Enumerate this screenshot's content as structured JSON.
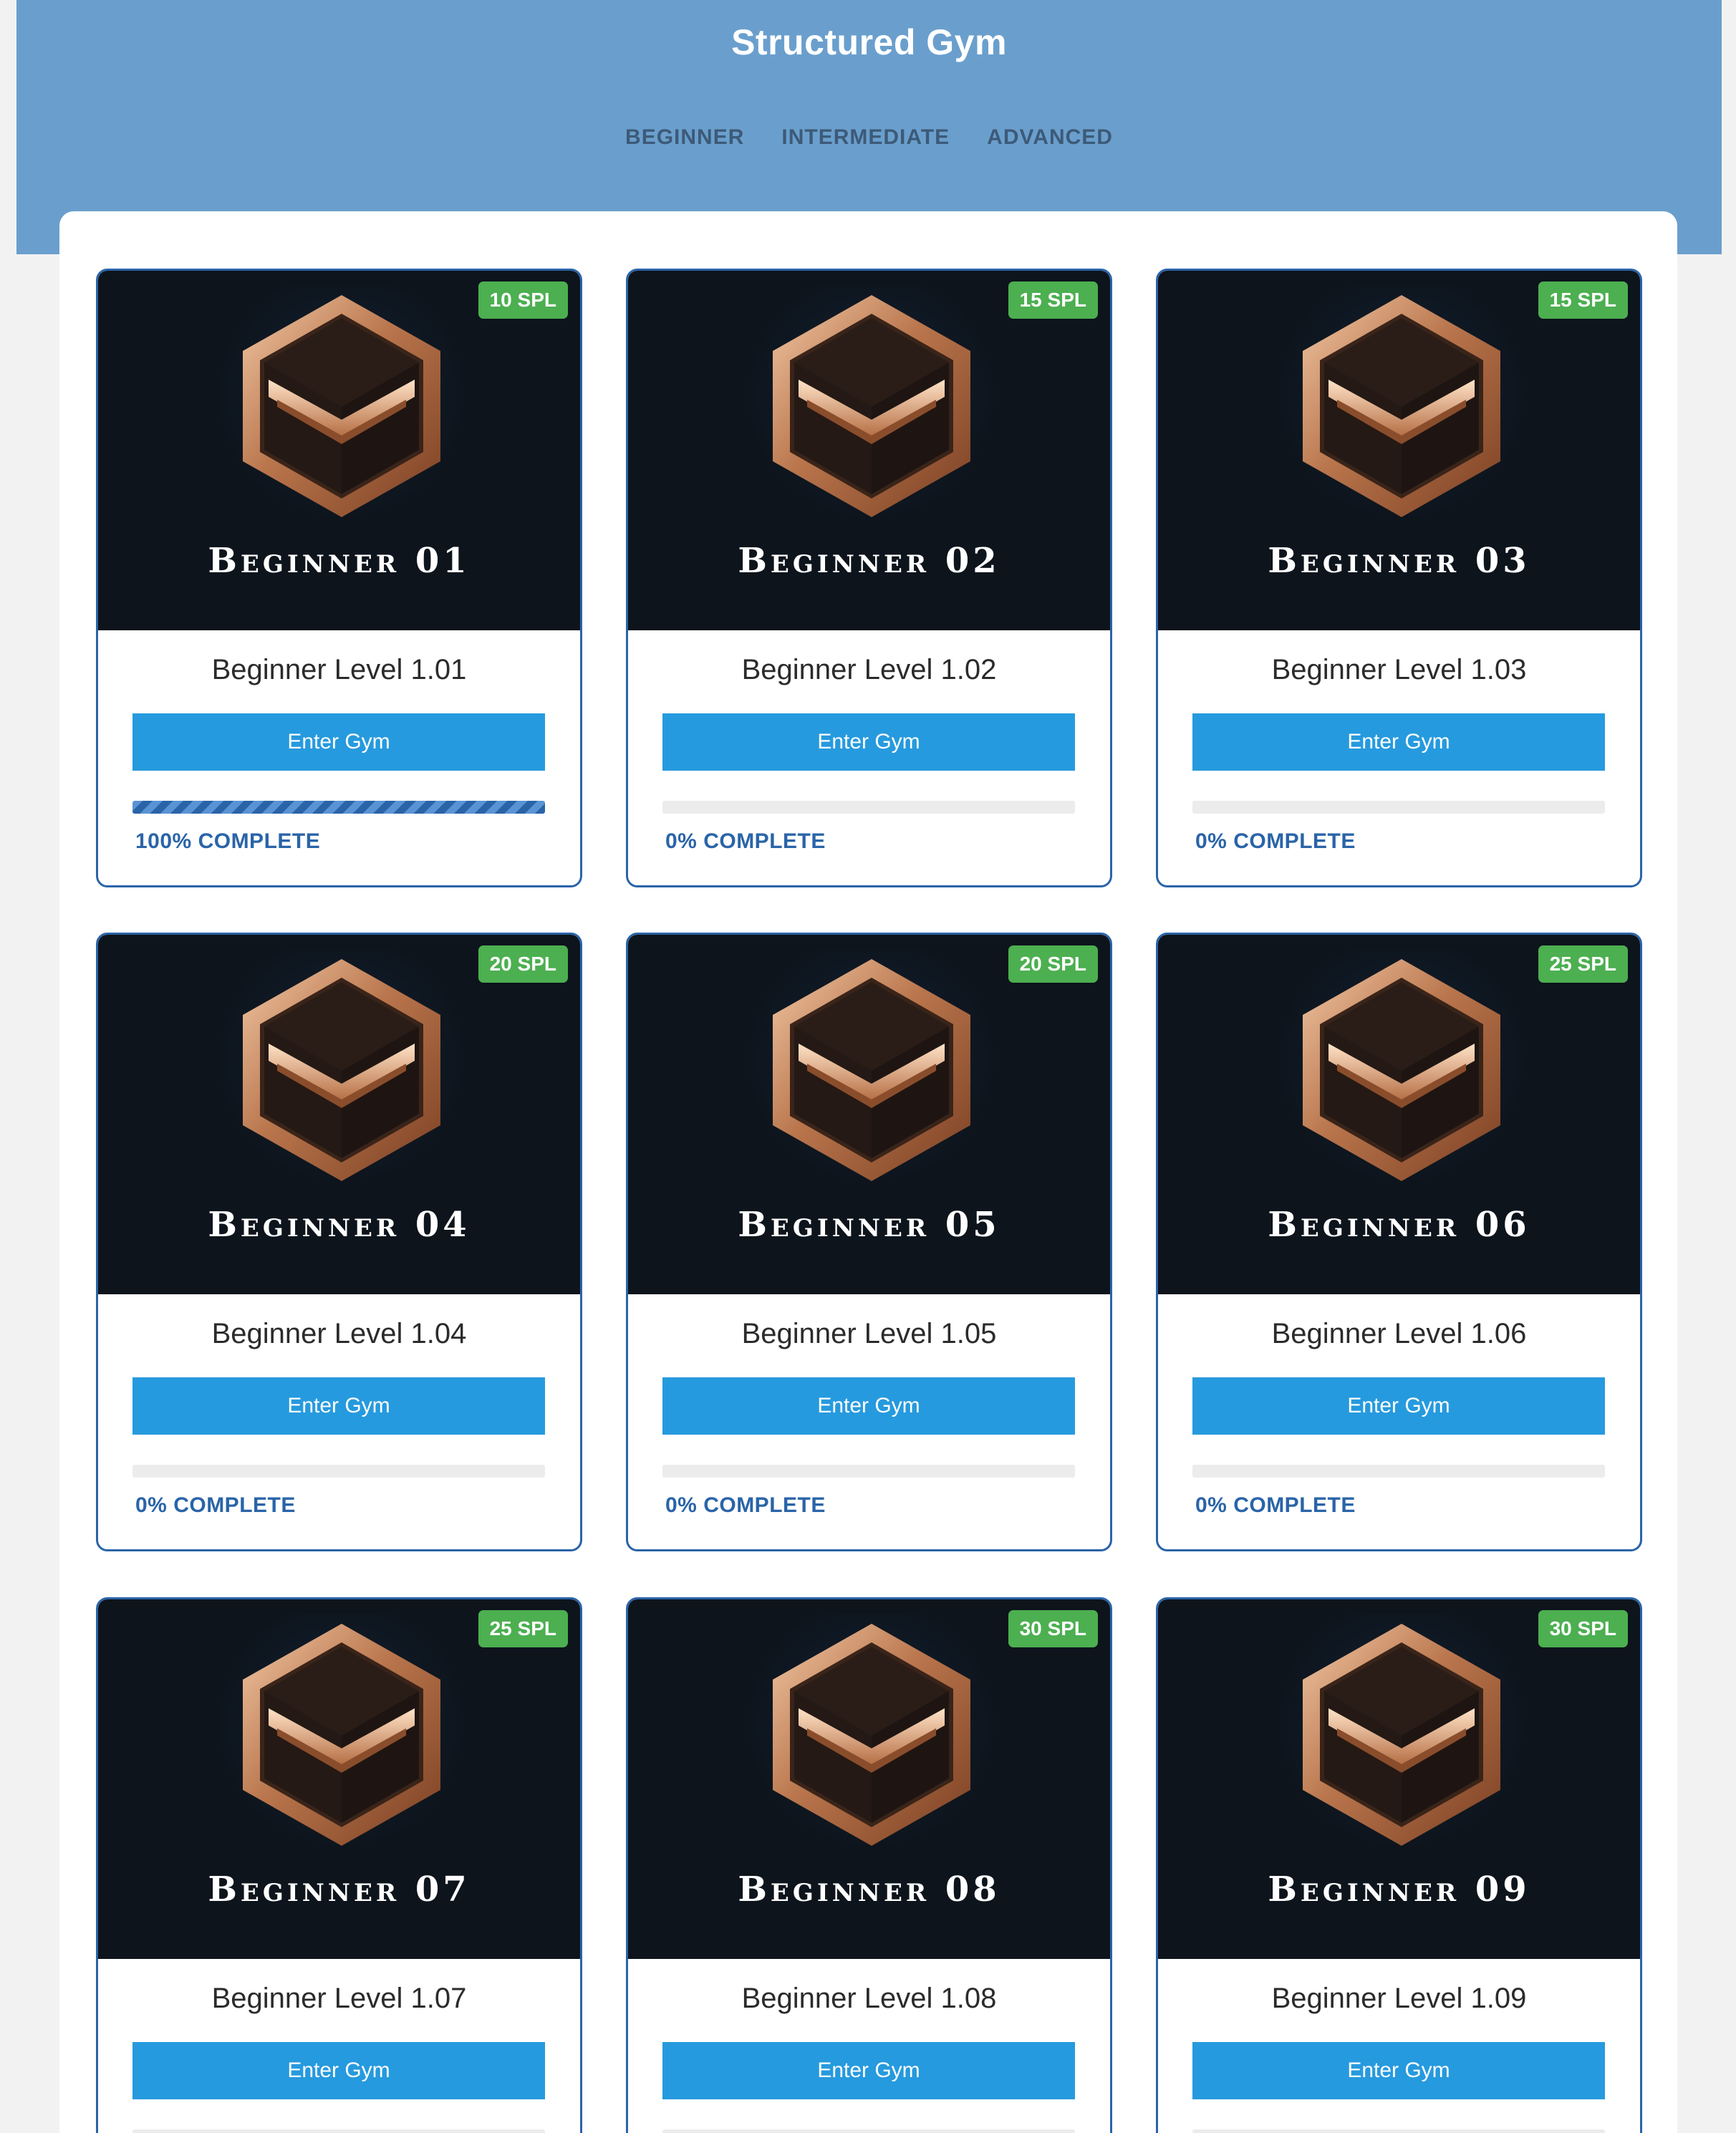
{
  "header": {
    "title": "Structured Gym",
    "tabs": [
      {
        "label": "BEGINNER"
      },
      {
        "label": "INTERMEDIATE"
      },
      {
        "label": "ADVANCED"
      }
    ]
  },
  "colors": {
    "header_bg": "#6a9fcd",
    "card_border": "#2a64a8",
    "button_bg": "#269ade",
    "spl_badge_bg": "#4caf50",
    "progress_text": "#2a64a8"
  },
  "cards": [
    {
      "art_text": "Beginner 01",
      "spl": "10 SPL",
      "title": "Beginner Level 1.01",
      "button": "Enter Gym",
      "progress": 100,
      "progress_text": "100% COMPLETE"
    },
    {
      "art_text": "Beginner 02",
      "spl": "15 SPL",
      "title": "Beginner Level 1.02",
      "button": "Enter Gym",
      "progress": 0,
      "progress_text": "0% COMPLETE"
    },
    {
      "art_text": "Beginner 03",
      "spl": "15 SPL",
      "title": "Beginner Level 1.03",
      "button": "Enter Gym",
      "progress": 0,
      "progress_text": "0% COMPLETE"
    },
    {
      "art_text": "Beginner 04",
      "spl": "20 SPL",
      "title": "Beginner Level 1.04",
      "button": "Enter Gym",
      "progress": 0,
      "progress_text": "0% COMPLETE"
    },
    {
      "art_text": "Beginner 05",
      "spl": "20 SPL",
      "title": "Beginner Level 1.05",
      "button": "Enter Gym",
      "progress": 0,
      "progress_text": "0% COMPLETE"
    },
    {
      "art_text": "Beginner 06",
      "spl": "25 SPL",
      "title": "Beginner Level 1.06",
      "button": "Enter Gym",
      "progress": 0,
      "progress_text": "0% COMPLETE"
    },
    {
      "art_text": "Beginner 07",
      "spl": "25 SPL",
      "title": "Beginner Level 1.07",
      "button": "Enter Gym",
      "progress": 0,
      "progress_text": ""
    },
    {
      "art_text": "Beginner 08",
      "spl": "30 SPL",
      "title": "Beginner Level 1.08",
      "button": "Enter Gym",
      "progress": 0,
      "progress_text": ""
    },
    {
      "art_text": "Beginner 09",
      "spl": "30 SPL",
      "title": "Beginner Level 1.09",
      "button": "Enter Gym",
      "progress": 0,
      "progress_text": ""
    }
  ]
}
